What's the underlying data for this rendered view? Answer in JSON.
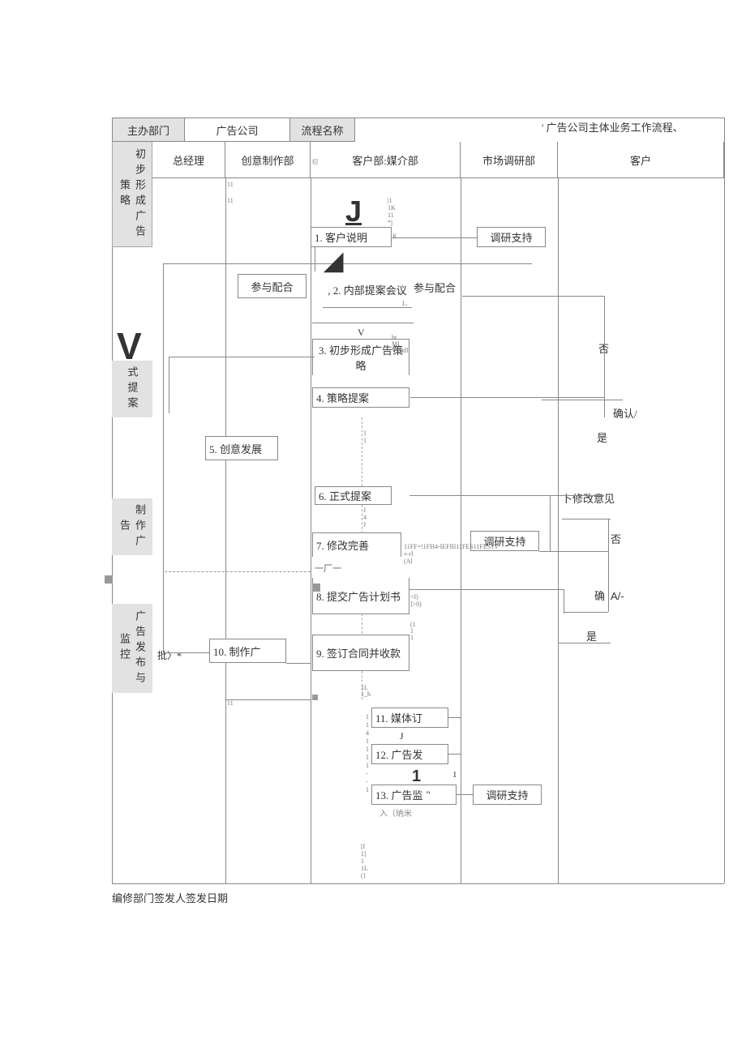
{
  "header": {
    "dept_label": "主办部门",
    "dept_value": "广告公司",
    "flow_label": "流程名称",
    "flow_value": "' 广告公司主体业务工作流程、"
  },
  "columns": {
    "phase_prelim": "初步形成广告策略",
    "phase_proposal": "式提案",
    "phase_make": "制作广告",
    "phase_publish": "广告发布与监控",
    "gm": "总经理",
    "creative": "创意制作部",
    "client_media": "客户部:媒介部",
    "research": "市场调研部",
    "customer": "客户"
  },
  "steps": {
    "s1": "1. 客户说明",
    "s2": ", 2. 内部提案会议",
    "s3": "3. 初步形成广告策略",
    "s4": "4. 策略提案",
    "s5": "5. 创意发展",
    "s6": "6. 正式提案",
    "s7": "7. 修改完善",
    "s8": "8. 提交广告计划书",
    "s9": "9. 签订合同并收款",
    "s10": "10. 制作广",
    "s11": "11. 媒体订",
    "s12": "12. 广告发",
    "s13": "13. 广告监"
  },
  "labels": {
    "research_support": "调研支持",
    "participate": "参与配合",
    "confirm": "确认/",
    "yes": "是",
    "no": "否",
    "revise_opinion": "卜修改意见",
    "que": "确",
    "approve": "批〉*",
    "dash3": "一厂一",
    "av": "A/-",
    "bigJ": "J",
    "bigV": "V",
    "smallV": "V",
    "one": "1",
    "smallJ": "J",
    "quote": "\"",
    "end": "入（纳米"
  },
  "footer": "编修部门签发人签发日期",
  "noise": {
    "n1": "11",
    "n2": "|1\n1K\n11\n*j",
    "n3": "K",
    "n4": "L.",
    "n5": "ht\nMI\nVIJ)tll",
    "n6": "1\n1",
    "n7": "J\n4\nJ",
    "n8": "11FF=!1FH4-IEFBl11FES11FES1V\n«-rl\n(Al",
    "n9": ">I)\n]>0)",
    "n10": "(1\n1\n1",
    "n11": "1L\n1_h",
    "n12": "1\n1\n4\n1\n1\n1\n1\n-\n-\n1",
    "n13": "[f\n1]\n1\n1L\n(1",
    "n14": "f|]"
  }
}
